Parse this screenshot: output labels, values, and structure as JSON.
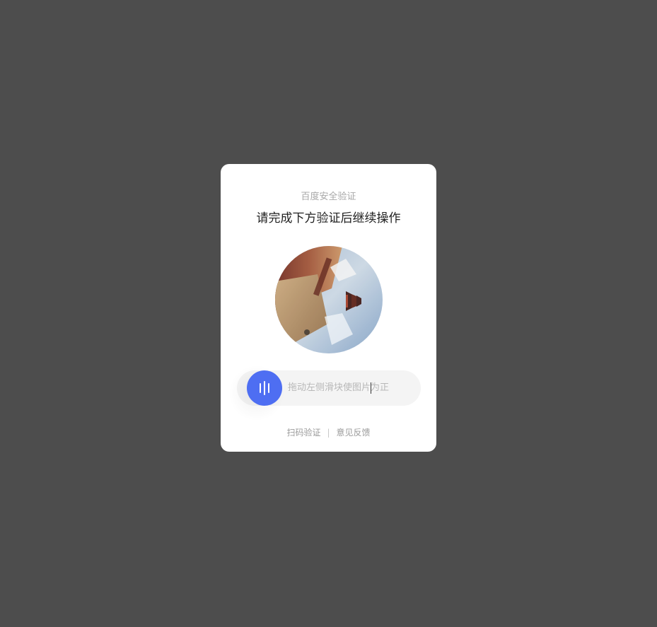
{
  "dialog": {
    "brand": "百度安全验证",
    "title": "请完成下方验证后继续操作"
  },
  "puzzle": {
    "image_alt": "rotated-photo-captcha"
  },
  "slider": {
    "hint": "拖动左侧滑块使图片为正",
    "handle_icon": "grip-lines-icon",
    "progress": 0
  },
  "footer": {
    "scan_link": "扫码验证",
    "separator": "|",
    "feedback_link": "意见反馈"
  },
  "colors": {
    "backdrop": "#4d4d4d",
    "card": "#ffffff",
    "accent": "#4e6ef2",
    "track": "#f4f4f4"
  }
}
